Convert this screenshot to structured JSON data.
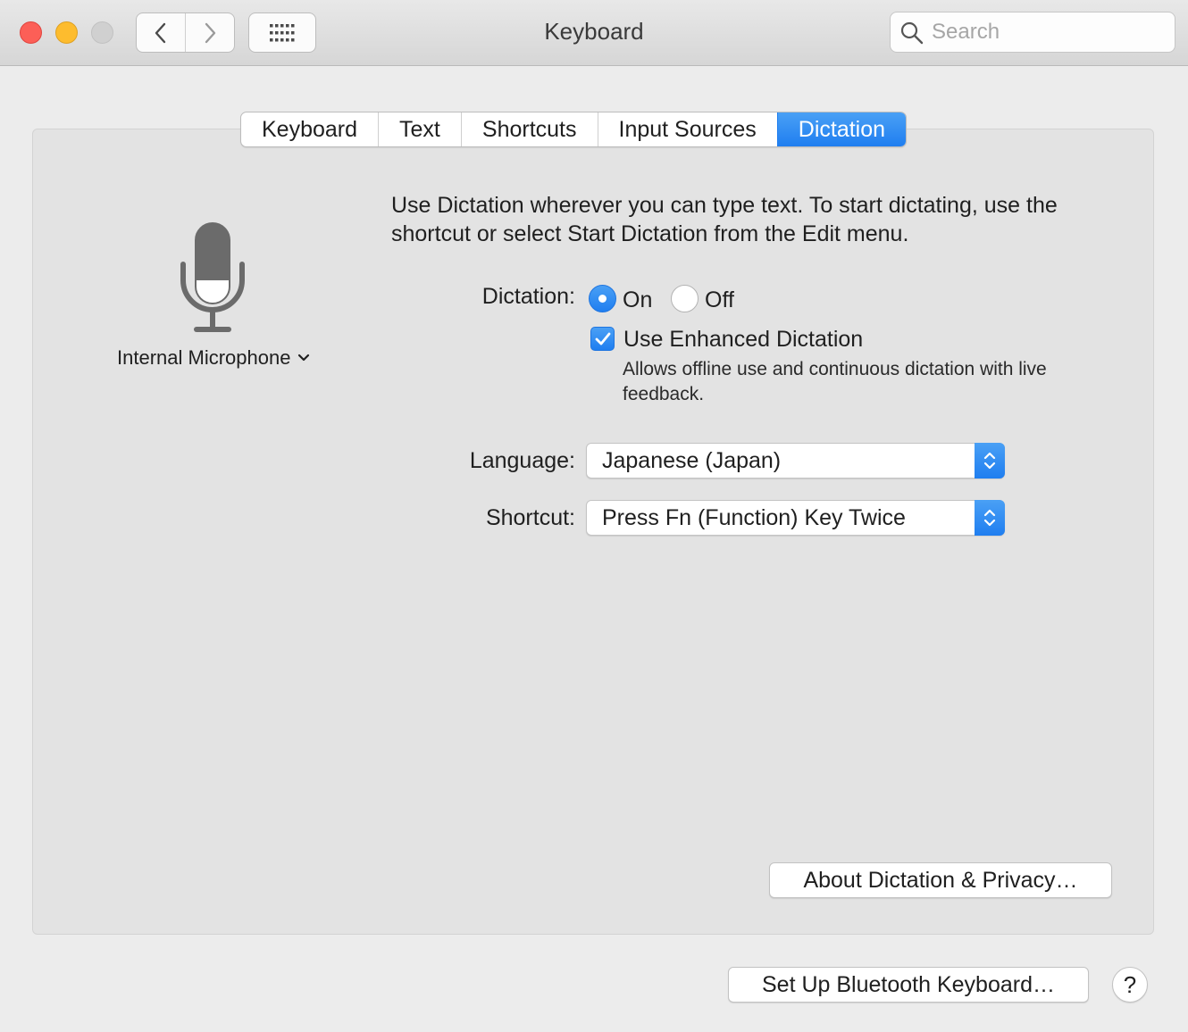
{
  "window": {
    "title": "Keyboard"
  },
  "toolbar": {
    "back_icon": "chevron-left-icon",
    "forward_icon": "chevron-right-icon",
    "show_all_icon": "grid-icon",
    "search_placeholder": "Search",
    "search_value": ""
  },
  "tabs": [
    {
      "label": "Keyboard",
      "selected": false
    },
    {
      "label": "Text",
      "selected": false
    },
    {
      "label": "Shortcuts",
      "selected": false
    },
    {
      "label": "Input Sources",
      "selected": false
    },
    {
      "label": "Dictation",
      "selected": true
    }
  ],
  "microphone": {
    "icon": "microphone-icon",
    "source": "Internal Microphone"
  },
  "dictation": {
    "description": "Use Dictation wherever you can type text. To start dictating, use the shortcut or select Start Dictation from the Edit menu.",
    "label": "Dictation:",
    "on_label": "On",
    "off_label": "Off",
    "selected": "On",
    "enhanced_label": "Use Enhanced Dictation",
    "enhanced_checked": true,
    "enhanced_description": "Allows offline use and continuous dictation with live feedback.",
    "language_label": "Language:",
    "language_value": "Japanese (Japan)",
    "shortcut_label": "Shortcut:",
    "shortcut_value": "Press Fn (Function) Key Twice",
    "about_button": "About Dictation & Privacy…"
  },
  "footer": {
    "bluetooth_button": "Set Up Bluetooth Keyboard…",
    "help_label": "?"
  },
  "colors": {
    "accent": "#1f7ef0",
    "close": "#fc5f57",
    "minimize": "#fdbc2e",
    "zoom_disabled": "#d0d0d0"
  }
}
